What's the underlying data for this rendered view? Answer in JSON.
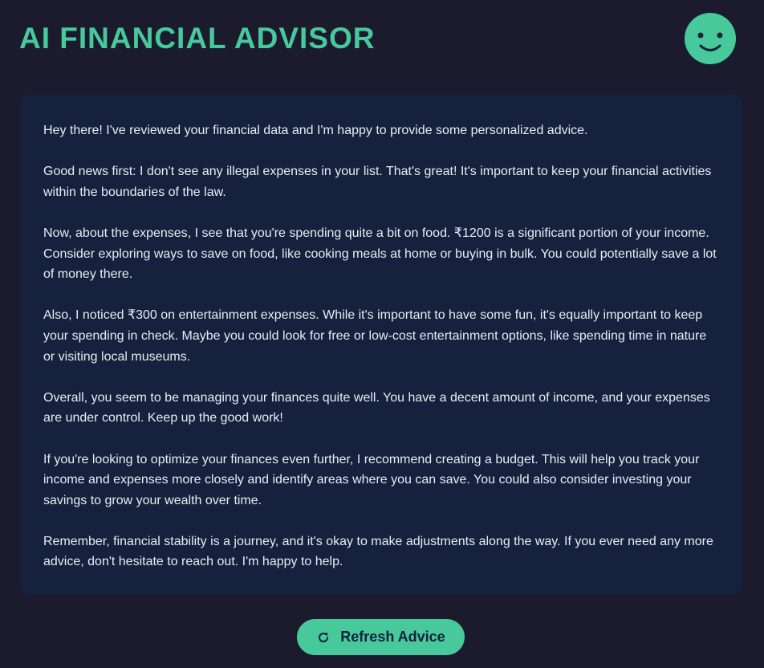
{
  "header": {
    "title": "AI FINANCIAL ADVISOR",
    "avatar_icon": "smiley-face-icon"
  },
  "advice": {
    "paragraphs": [
      "Hey there! I've reviewed your financial data and I'm happy to provide some personalized advice.",
      "Good news first: I don't see any illegal expenses in your list. That's great! It's important to keep your financial activities within the boundaries of the law.",
      "Now, about the expenses, I see that you're spending quite a bit on food. ₹1200 is a significant portion of your income. Consider exploring ways to save on food, like cooking meals at home or buying in bulk. You could potentially save a lot of money there.",
      "Also, I noticed ₹300 on entertainment expenses. While it's important to have some fun, it's equally important to keep your spending in check. Maybe you could look for free or low-cost entertainment options, like spending time in nature or visiting local museums.",
      "Overall, you seem to be managing your finances quite well. You have a decent amount of income, and your expenses are under control. Keep up the good work!",
      "If you're looking to optimize your finances even further, I recommend creating a budget. This will help you track your income and expenses more closely and identify areas where you can save. You could also consider investing your savings to grow your wealth over time.",
      "Remember, financial stability is a journey, and it's okay to make adjustments along the way. If you ever need any more advice, don't hesitate to reach out. I'm happy to help."
    ]
  },
  "actions": {
    "refresh_label": "Refresh Advice",
    "refresh_icon": "refresh-icon"
  },
  "colors": {
    "background": "#1b1b2d",
    "card": "#15213d",
    "accent": "#47c99c",
    "text": "#e9ecf2"
  }
}
